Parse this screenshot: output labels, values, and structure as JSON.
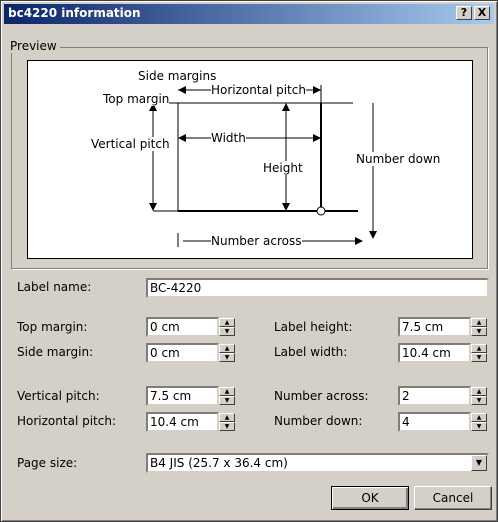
{
  "window": {
    "title": "bc4220 information",
    "help_glyph": "?",
    "close_glyph": "X"
  },
  "preview": {
    "group_label": "Preview",
    "labels": {
      "side_margins": "Side margins",
      "top_margin": "Top margin",
      "horizontal_pitch": "Horizontal pitch",
      "vertical_pitch": "Vertical pitch",
      "width": "Width",
      "height": "Height",
      "number_down": "Number down",
      "number_across": "Number across"
    }
  },
  "form": {
    "label_name": {
      "label": "Label name:",
      "value": "BC-4220"
    },
    "top_margin": {
      "label": "Top margin:",
      "value": "0 cm"
    },
    "side_margin": {
      "label": "Side margin:",
      "value": "0 cm"
    },
    "vertical_pitch": {
      "label": "Vertical pitch:",
      "value": "7.5 cm"
    },
    "horizontal_pitch": {
      "label": "Horizontal pitch:",
      "value": "10.4 cm"
    },
    "label_height": {
      "label": "Label height:",
      "value": "7.5 cm"
    },
    "label_width": {
      "label": "Label width:",
      "value": "10.4 cm"
    },
    "number_across": {
      "label": "Number across:",
      "value": "2"
    },
    "number_down": {
      "label": "Number down:",
      "value": "4"
    },
    "page_size": {
      "label": "Page size:",
      "value": "B4 JIS (25.7 x 36.4 cm)"
    }
  },
  "buttons": {
    "ok": "OK",
    "cancel": "Cancel"
  },
  "icons": {
    "spin_up": "up-arrow-icon",
    "spin_down": "down-arrow-icon",
    "dropdown": "chevron-down-icon"
  },
  "colors": {
    "titlebar_start": "#0a246a",
    "titlebar_end": "#a6caf0",
    "face": "#d4d0c8"
  }
}
